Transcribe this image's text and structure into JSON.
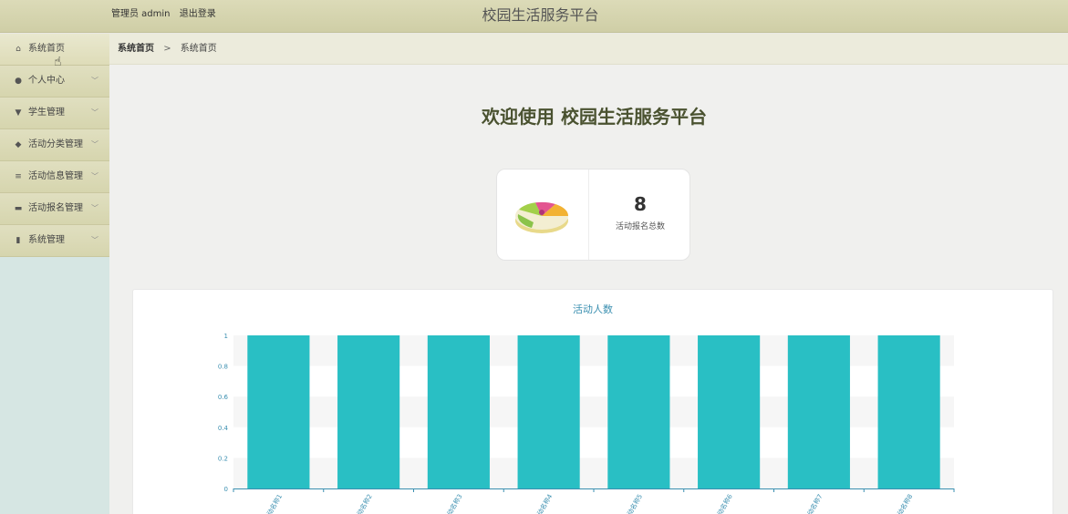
{
  "header": {
    "admin_label": "管理员 admin",
    "logout_label": "退出登录",
    "title": "校园生活服务平台"
  },
  "sidebar": {
    "items": [
      {
        "label": "系统首页",
        "icon": "home-icon",
        "glyph": "⌂",
        "active": true,
        "chevron": false
      },
      {
        "label": "个人中心",
        "icon": "user-icon",
        "glyph": "●",
        "active": false,
        "chevron": true
      },
      {
        "label": "学生管理",
        "icon": "trophy-icon",
        "glyph": "▼",
        "active": false,
        "chevron": true
      },
      {
        "label": "活动分类管理",
        "icon": "pin-icon",
        "glyph": "◆",
        "active": false,
        "chevron": true
      },
      {
        "label": "活动信息管理",
        "icon": "sliders-icon",
        "glyph": "≡",
        "active": false,
        "chevron": true
      },
      {
        "label": "活动报名管理",
        "icon": "briefcase-icon",
        "glyph": "▬",
        "active": false,
        "chevron": true
      },
      {
        "label": "系统管理",
        "icon": "bar-chart-icon",
        "glyph": "▮",
        "active": false,
        "chevron": true
      }
    ],
    "chevron_glyph": "﹀"
  },
  "breadcrumb": {
    "home": "系统首页",
    "separator": ">",
    "current": "系统首页"
  },
  "main": {
    "welcome": "欢迎使用 校园生活服务平台",
    "stat": {
      "value": "8",
      "label": "活动报名总数"
    }
  },
  "chart_data": {
    "type": "bar",
    "title": "活动人数",
    "categories": [
      "活动名称1",
      "活动名称2",
      "活动名称3",
      "活动名称4",
      "活动名称5",
      "活动名称6",
      "活动名称7",
      "活动名称8"
    ],
    "values": [
      1,
      1,
      1,
      1,
      1,
      1,
      1,
      1
    ],
    "ylim": [
      0,
      1
    ],
    "yticks": [
      0,
      0.2,
      0.4,
      0.6,
      0.8,
      1
    ],
    "bar_color": "#29bfc4",
    "axis_color": "#3a8fb0"
  },
  "colors": {
    "topbar": "#d4d3ac",
    "sidebar_bg": "#d6e6e3",
    "welcome_text": "#4a5230"
  }
}
